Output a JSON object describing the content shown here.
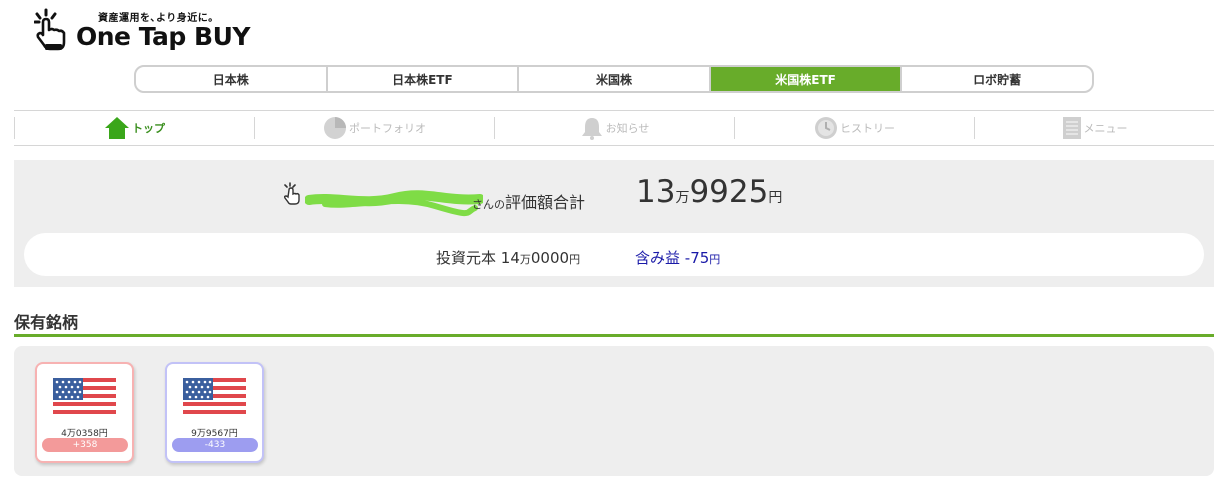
{
  "logo": {
    "tagline": "資産運用を､より身近に｡",
    "name": "One Tap BUY"
  },
  "market_tabs": [
    {
      "label": "日本株",
      "active": false
    },
    {
      "label": "日本株ETF",
      "active": false
    },
    {
      "label": "米国株",
      "active": false
    },
    {
      "label": "米国株ETF",
      "active": true
    },
    {
      "label": "ロボ貯蓄",
      "active": false
    }
  ],
  "subnav": [
    {
      "label": "トップ",
      "icon": "home-icon"
    },
    {
      "label": "ポートフォリオ",
      "icon": "pie-chart-icon"
    },
    {
      "label": "お知らせ",
      "icon": "bell-icon"
    },
    {
      "label": "ヒストリー",
      "icon": "clock-icon"
    },
    {
      "label": "メニュー",
      "icon": "menu-icon"
    }
  ],
  "summary": {
    "suffix": "さんの",
    "label": "評価額合計",
    "amount_man": "13",
    "unit_man": "万",
    "amount_rest": "9925",
    "unit_yen": "円",
    "principal_label": "投資元本",
    "principal_man": "14",
    "principal_rest": "0000",
    "gain_label": "含み益",
    "gain_value": "-75"
  },
  "holdings": {
    "title": "保有銘柄",
    "items": [
      {
        "flag": "us-flag-icon",
        "value": "4万0358円",
        "change": "+358",
        "trend": "up"
      },
      {
        "flag": "us-flag-icon",
        "value": "9万9567円",
        "change": "-433",
        "trend": "down"
      }
    ]
  },
  "colors": {
    "accent": "#68ac2a",
    "gain_text": "#1a1aa8",
    "positive": "#f39a9a",
    "negative": "#9d9df0",
    "panel": "#eeeeee"
  }
}
